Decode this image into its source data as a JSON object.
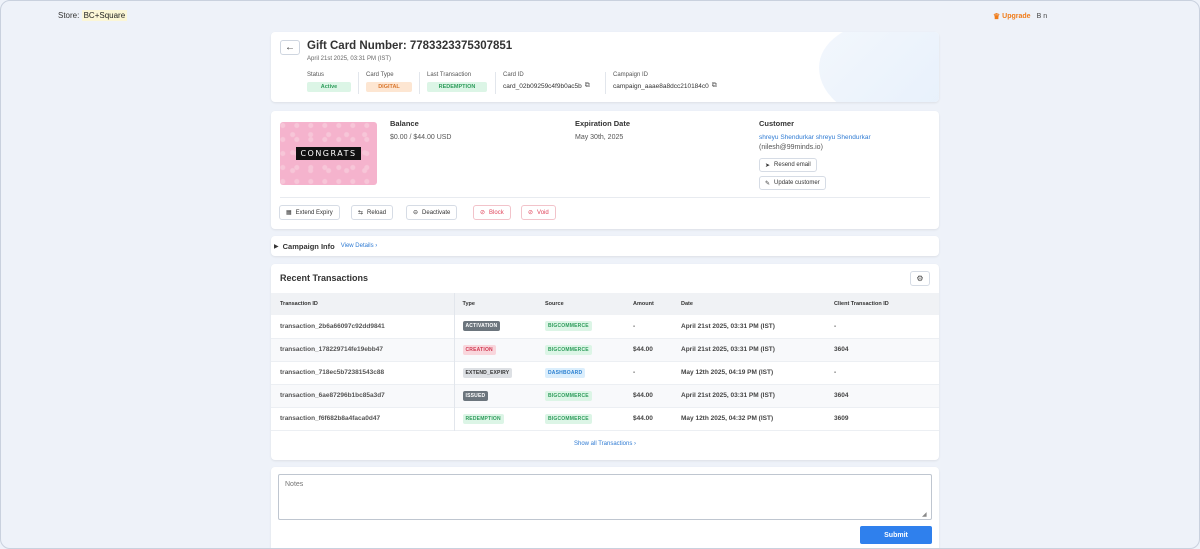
{
  "store": {
    "label": "Store:",
    "name": "BC+Square"
  },
  "topbar": {
    "upgrade": "Upgrade",
    "lang": "B",
    "user": "n"
  },
  "header": {
    "title": "Gift Card Number: 7783323375307851",
    "date": "April 21st 2025, 03:31 PM (IST)",
    "status": {
      "label": "Status",
      "value": "Active"
    },
    "card_type": {
      "label": "Card Type",
      "value": "DIGITAL"
    },
    "last_tx": {
      "label": "Last Transaction",
      "value": "REDEMPTION"
    },
    "card_id": {
      "label": "Card ID",
      "value": "card_02b09259c4f9b0ac5b"
    },
    "campaign_id": {
      "label": "Campaign ID",
      "value": "campaign_aaae8a8dcc210184c0"
    }
  },
  "gift_card_image_text": "CONGRATS",
  "balance": {
    "label": "Balance",
    "value": "$0.00 / $44.00 USD"
  },
  "expiration": {
    "label": "Expiration Date",
    "value": "May 30th, 2025"
  },
  "customer": {
    "label": "Customer",
    "name": "shreyu Shendurkar shreyu Shendurkar",
    "email": "(nilesh@99minds.io)",
    "resend_email": "Resend email",
    "update_customer": "Update customer"
  },
  "actions": {
    "extend_expiry": "Extend Expiry",
    "reload": "Reload",
    "deactivate": "Deactivate",
    "block": "Block",
    "void": "Void"
  },
  "campaign": {
    "label": "Campaign Info",
    "link": "View Details ›"
  },
  "transactions": {
    "title": "Recent Transactions",
    "columns": [
      "Transaction ID",
      "Type",
      "Source",
      "Amount",
      "Date",
      "Client Transaction ID"
    ],
    "rows": [
      {
        "id": "transaction_2b6a66097c92dd9841",
        "type": "ACTIVATION",
        "source": "BIGCOMMERCE",
        "amount": "-",
        "date": "April 21st 2025, 03:31 PM (IST)",
        "client_id": "-"
      },
      {
        "id": "transaction_178229714fe19ebb47",
        "type": "CREATION",
        "source": "BIGCOMMERCE",
        "amount": "$44.00",
        "date": "April 21st 2025, 03:31 PM (IST)",
        "client_id": "3604"
      },
      {
        "id": "transaction_718ec5b72381543c88",
        "type": "EXTEND_EXPIRY",
        "source": "DASHBOARD",
        "amount": "-",
        "date": "May 12th 2025, 04:19 PM (IST)",
        "client_id": "-"
      },
      {
        "id": "transaction_6ae87296b1bc85a3d7",
        "type": "ISSUED",
        "source": "BIGCOMMERCE",
        "amount": "$44.00",
        "date": "April 21st 2025, 03:31 PM (IST)",
        "client_id": "3604"
      },
      {
        "id": "transaction_f6f682b8a4faca0d47",
        "type": "REDEMPTION",
        "source": "BIGCOMMERCE",
        "amount": "$44.00",
        "date": "May 12th 2025, 04:32 PM (IST)",
        "client_id": "3609"
      }
    ],
    "show_all": "Show all Transactions ›"
  },
  "notes": {
    "placeholder": "Notes",
    "submit": "Submit"
  }
}
